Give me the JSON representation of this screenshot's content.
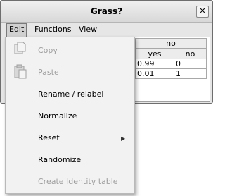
{
  "window": {
    "title": "Grass?",
    "close_glyph": "✕"
  },
  "menubar": {
    "items": [
      "Edit",
      "Functions",
      "View"
    ]
  },
  "table": {
    "header_top": [
      "no"
    ],
    "header_cols": [
      "yes",
      "no"
    ],
    "rows": [
      [
        "0.99",
        "0"
      ],
      [
        "0.01",
        "1"
      ]
    ]
  },
  "edit_menu": {
    "items": [
      {
        "label": "Copy",
        "enabled": false,
        "icon": "copy-icon"
      },
      {
        "label": "Paste",
        "enabled": false,
        "icon": "paste-icon"
      },
      {
        "label": "Rename / relabel",
        "enabled": true
      },
      {
        "label": "Normalize",
        "enabled": true
      },
      {
        "label": "Reset",
        "enabled": true,
        "submenu_glyph": "▶"
      },
      {
        "label": "Randomize",
        "enabled": true
      },
      {
        "label": "Create Identity table",
        "enabled": false
      }
    ]
  }
}
